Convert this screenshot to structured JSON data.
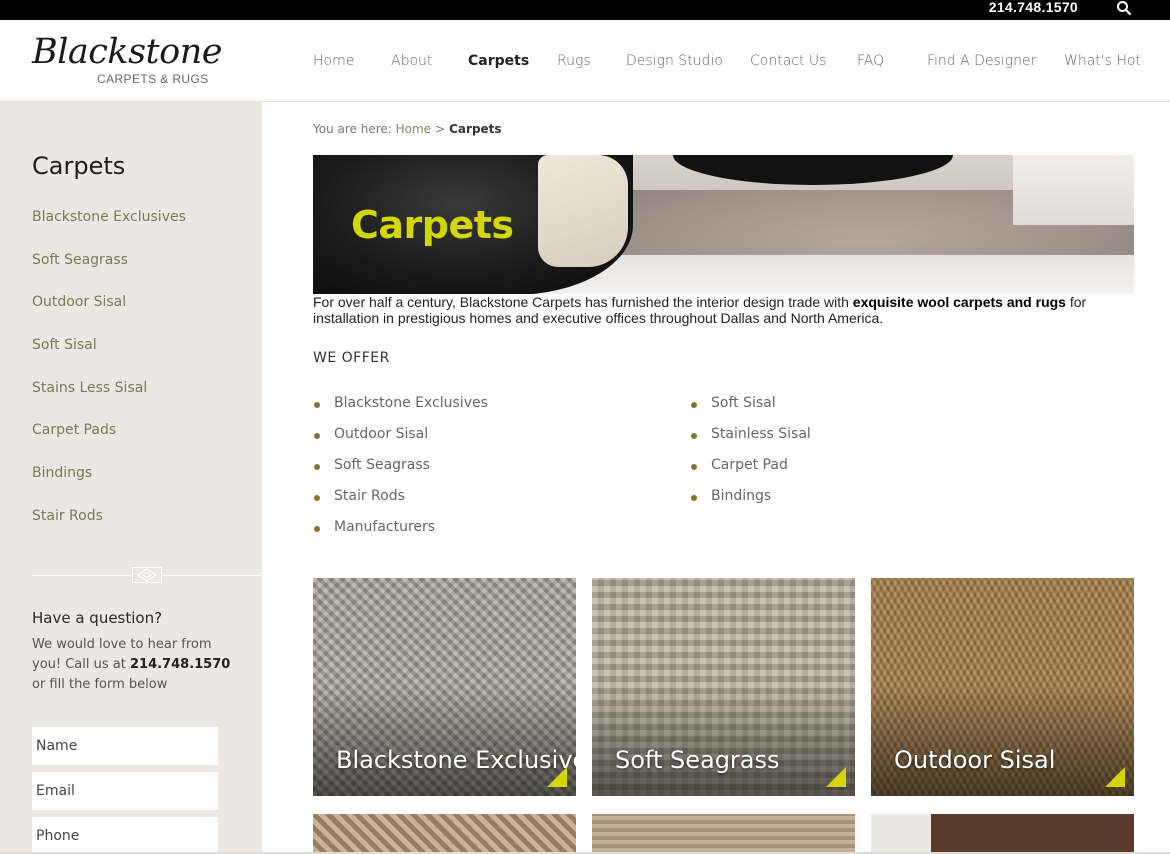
{
  "topbar": {
    "phone": "214.748.1570",
    "search_icon": "search-icon"
  },
  "header": {
    "logo_script": "Blackstone",
    "logo_sub": "CARPETS & RUGS",
    "nav": [
      {
        "label": "Home"
      },
      {
        "label": "About"
      },
      {
        "label": "Carpets",
        "active": true
      },
      {
        "label": "Rugs"
      },
      {
        "label": "Design Studio"
      },
      {
        "label": "Contact Us"
      },
      {
        "label": "FAQ"
      },
      {
        "label": "Find A Designer"
      },
      {
        "label": "What's Hot"
      }
    ]
  },
  "sidebar": {
    "title": "Carpets",
    "links": [
      "Blackstone Exclusives",
      "Soft Seagrass",
      "Outdoor Sisal",
      "Soft Sisal",
      "Stains Less Sisal",
      "Carpet Pads",
      "Bindings",
      "Stair Rods"
    ],
    "question_title": "Have a question?",
    "question_text_a": "We would love to hear from you! Call us at ",
    "question_phone": "214.748.1570",
    "question_text_b": " or fill the form below",
    "form": {
      "name_placeholder": "Name",
      "email_placeholder": "Email",
      "phone_placeholder": "Phone"
    }
  },
  "main": {
    "breadcrumb": {
      "prefix": "You are here: ",
      "home": "Home",
      "sep": ">",
      "current": "Carpets"
    },
    "hero_title": "Carpets",
    "intro_a": "For over half a century, Blackstone Carpets has furnished the interior design trade with ",
    "intro_bold": "exquisite wool carpets and rugs",
    "intro_b": " for installation in prestigious homes and executive offices throughout Dallas and North America.",
    "offer_title": "WE OFFER",
    "offer_left": [
      "Blackstone Exclusives",
      "Outdoor Sisal",
      "Soft Seagrass",
      "Stair Rods",
      "Manufacturers"
    ],
    "offer_right": [
      "Soft Sisal",
      "Stainless Sisal",
      "Carpet Pad",
      "Bindings"
    ],
    "tiles": [
      "Blackstone Exclusives",
      "Soft Seagrass",
      "Outdoor Sisal"
    ]
  },
  "colors": {
    "accent": "#d3d600",
    "sidebar_bg": "#ebe7e2",
    "link": "#7b7856",
    "bullet": "#7a7a2a"
  }
}
